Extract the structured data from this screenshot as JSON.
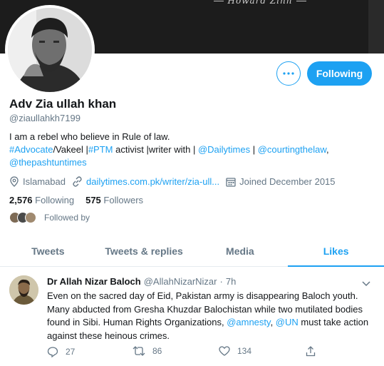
{
  "banner": {
    "quote": "Howard Zinn"
  },
  "profile": {
    "name": "Adv Zia ullah khan",
    "handle": "@ziaullahkh7199",
    "bio": {
      "line1": "I am a rebel who believe in Rule of law.",
      "h1": "#Advocate",
      "t1": "/Vakeel |",
      "h2": "#PTM",
      "t2": " activist |writer with | ",
      "m1": "@Dailytimes",
      "t3": " | ",
      "m2": "@courtingthelaw",
      "t4": ",",
      "m3": "@thepashtuntimes"
    },
    "location": "Islamabad",
    "website": "dailytimes.com.pk/writer/zia-ull...",
    "joined": "Joined December 2015",
    "following_count": "2,576",
    "following_label": "Following",
    "followers_count": "575",
    "followers_label": "Followers",
    "followed_by": "Followed by"
  },
  "actions": {
    "follow_label": "Following",
    "more_icon": "more-icon"
  },
  "tabs": [
    {
      "label": "Tweets"
    },
    {
      "label": "Tweets & replies"
    },
    {
      "label": "Media"
    },
    {
      "label": "Likes"
    }
  ],
  "tweet": {
    "author": "Dr Allah Nizar Baloch",
    "handle": "@AllahNizarNizar",
    "sep": "·",
    "time": "7h",
    "text1": "Even on the sacred day of Eid, Pakistan army is disappearing Baloch youth. Many abducted from Gresha Khuzdar Balochistan while two mutilated bodies found in Sibi. Human Rights Organizations, ",
    "mention1": "@amnesty",
    "text2": ", ",
    "mention2": "@UN",
    "text3": " must take action against these heinous crimes.",
    "replies": "27",
    "retweets": "86",
    "likes": "134"
  },
  "colors": {
    "accent": "#1da1f2",
    "muted": "#657786",
    "text": "#14171a"
  }
}
